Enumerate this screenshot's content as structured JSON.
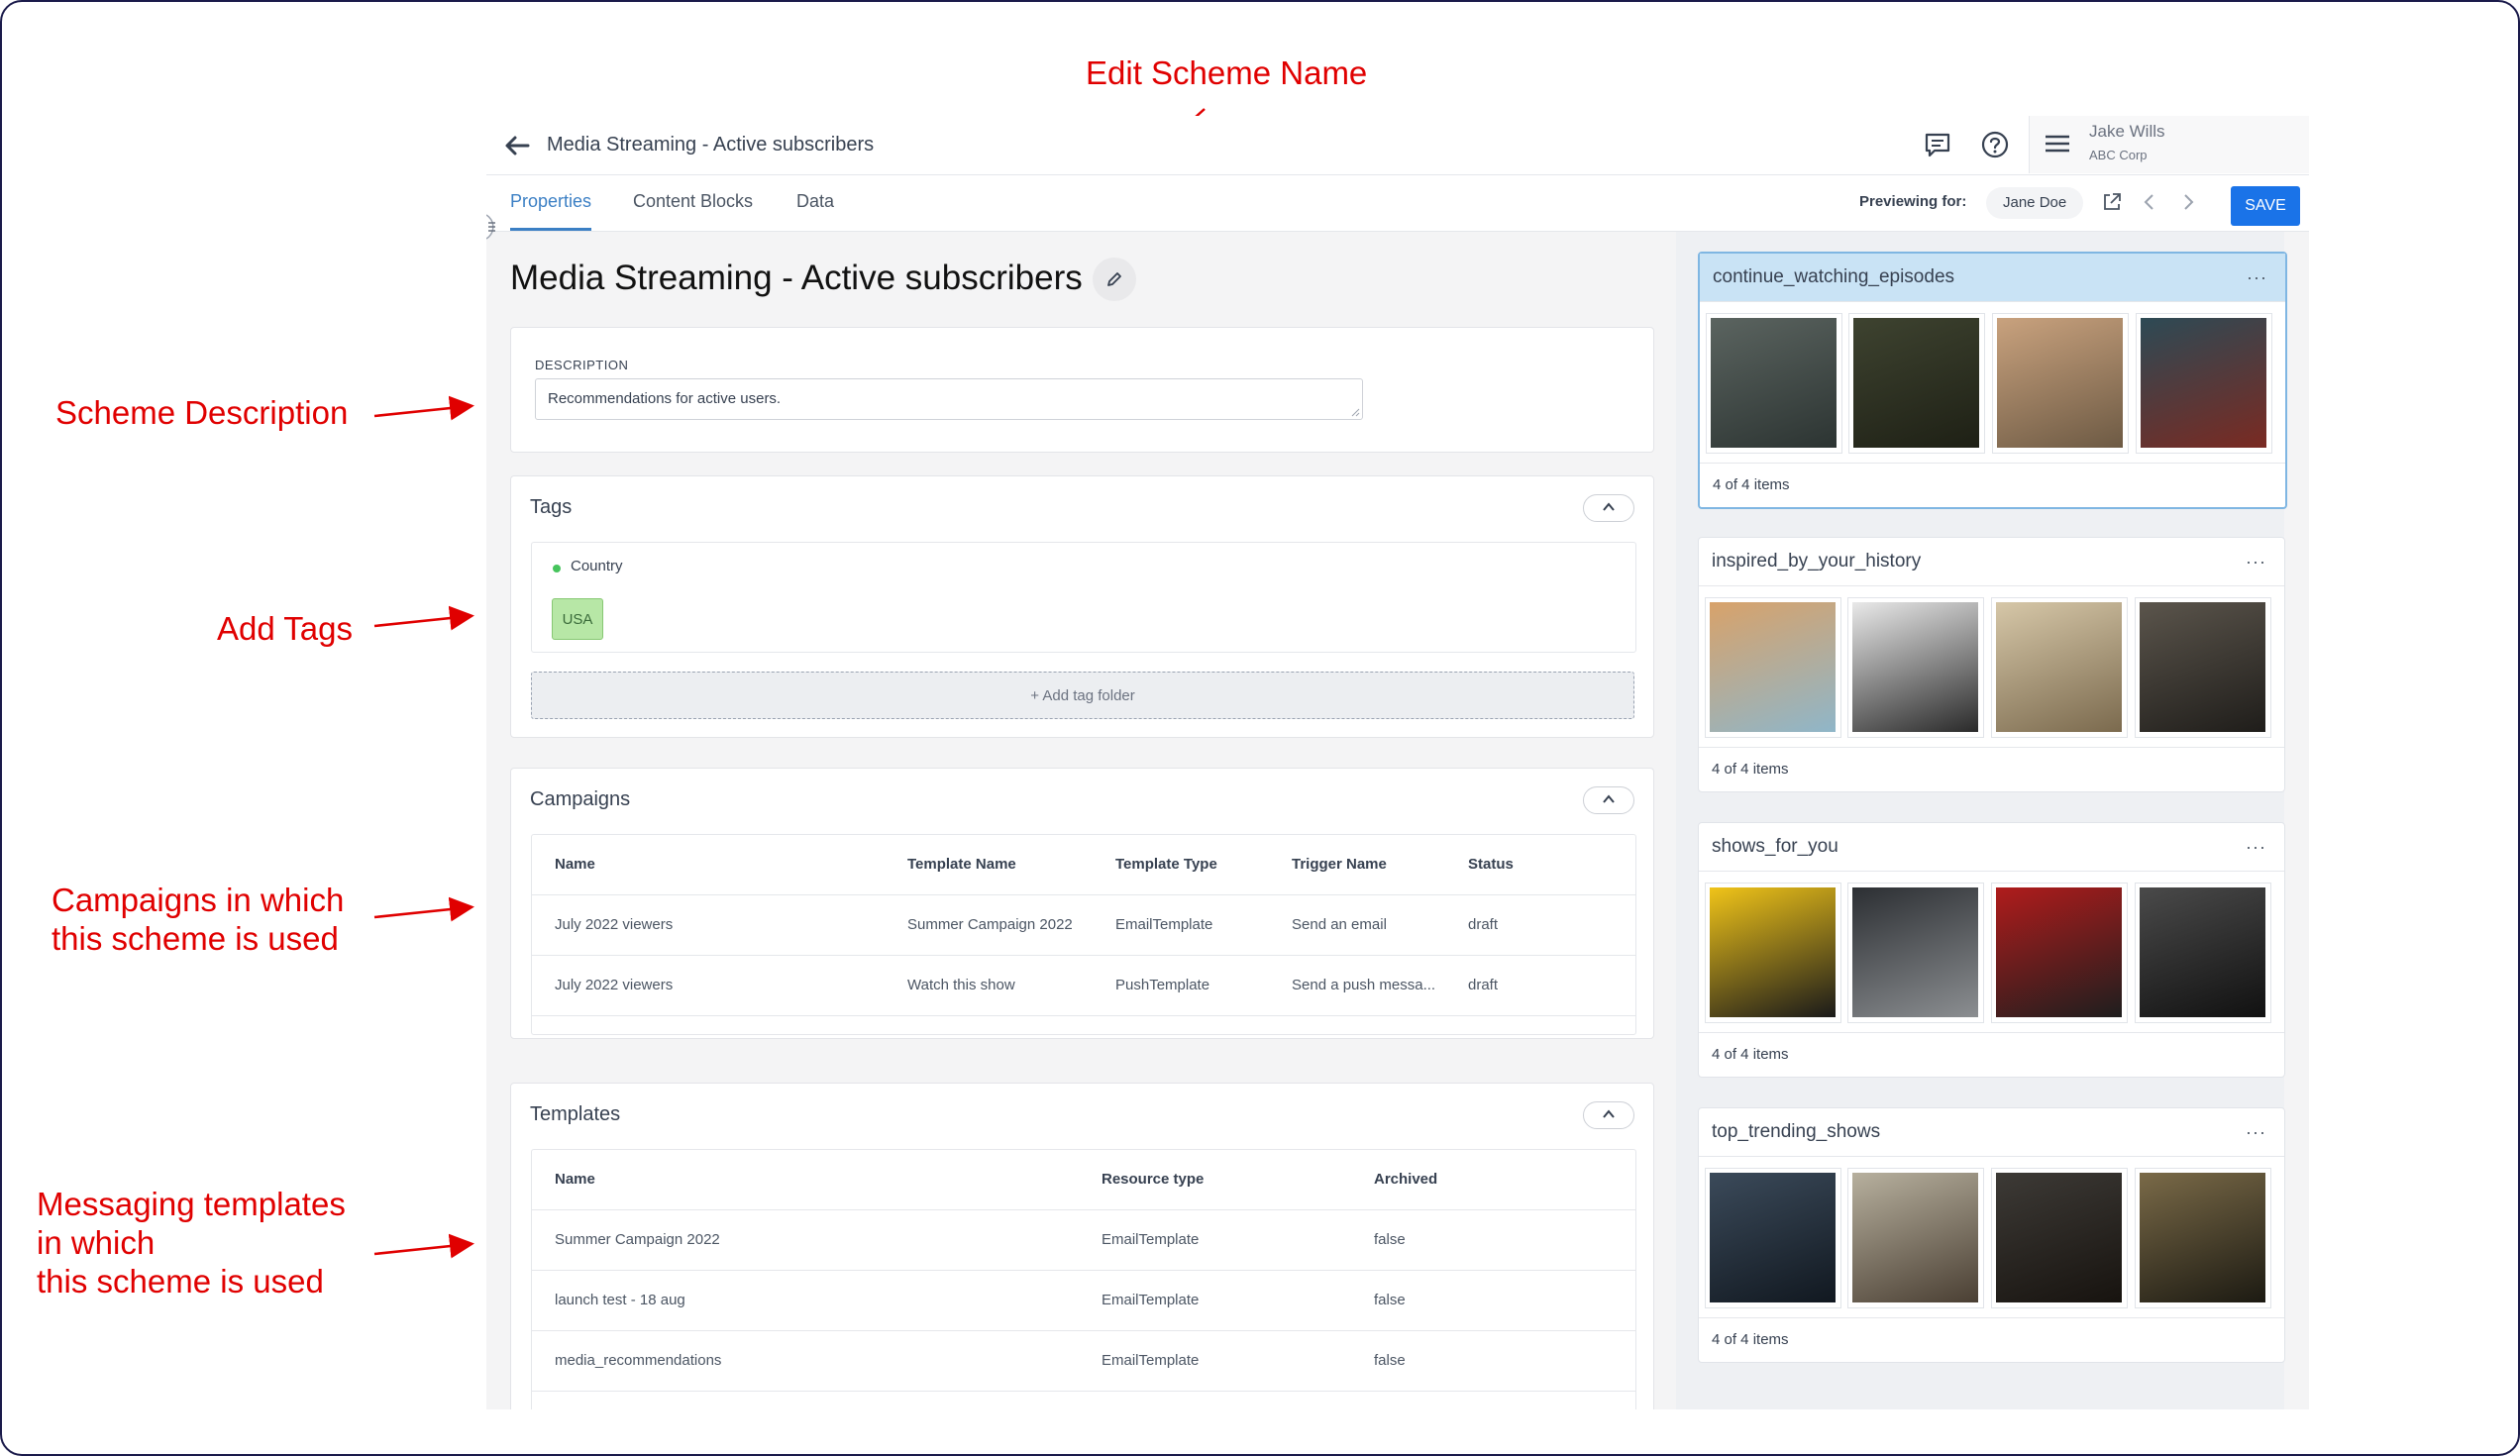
{
  "annotations": {
    "edit_name": "Edit Scheme Name",
    "description": "Scheme Description",
    "tags": "Add Tags",
    "campaigns": "Campaigns in which\nthis scheme is used",
    "templates": "Messaging templates\n in which\nthis scheme is used"
  },
  "header": {
    "title": "Media Streaming - Active subscribers",
    "user_name": "Jake Wills",
    "user_org": "ABC Corp"
  },
  "tabs": [
    {
      "label": "Properties",
      "active": true
    },
    {
      "label": "Content Blocks",
      "active": false
    },
    {
      "label": "Data",
      "active": false
    }
  ],
  "preview": {
    "label": "Previewing for:",
    "user": "Jane Doe",
    "save_label": "SAVE"
  },
  "scheme": {
    "title": "Media Streaming - Active subscribers",
    "description_label": "DESCRIPTION",
    "description": "Recommendations for active users."
  },
  "tags": {
    "heading": "Tags",
    "folder": "Country",
    "chips": [
      "USA"
    ],
    "add_label": "+ Add tag folder"
  },
  "campaigns": {
    "heading": "Campaigns",
    "columns": [
      "Name",
      "Template Name",
      "Template Type",
      "Trigger Name",
      "Status"
    ],
    "rows": [
      [
        "July 2022 viewers",
        "Summer Campaign 2022",
        "EmailTemplate",
        "Send an email",
        "draft"
      ],
      [
        "July 2022 viewers",
        "Watch this show",
        "PushTemplate",
        "Send a push messa...",
        "draft"
      ]
    ]
  },
  "templates": {
    "heading": "Templates",
    "columns": [
      "Name",
      "Resource type",
      "Archived"
    ],
    "rows": [
      [
        "Summer Campaign 2022",
        "EmailTemplate",
        "false"
      ],
      [
        "launch test - 18 aug",
        "EmailTemplate",
        "false"
      ],
      [
        "media_recommendations",
        "EmailTemplate",
        "false"
      ]
    ]
  },
  "content_blocks": [
    {
      "name": "continue_watching_episodes",
      "count": "4 of 4 items",
      "selected": true,
      "thumbs": [
        [
          "#5b6460",
          "#2c3432"
        ],
        [
          "#3e4330",
          "#1e2015"
        ],
        [
          "#c9a27e",
          "#6d5a44"
        ],
        [
          "#2d4a55",
          "#7a2a22"
        ]
      ]
    },
    {
      "name": "inspired_by_your_history",
      "count": "4 of 4 items",
      "selected": false,
      "thumbs": [
        [
          "#d8a26a",
          "#8fb6c9"
        ],
        [
          "#e9e9e9",
          "#2a2a2a"
        ],
        [
          "#d6c7a8",
          "#7b6a4e"
        ],
        [
          "#5b554c",
          "#1f1d1a"
        ]
      ]
    },
    {
      "name": "shows_for_you",
      "count": "4 of 4 items",
      "selected": false,
      "thumbs": [
        [
          "#f0c419",
          "#1a1a1a"
        ],
        [
          "#2c2f33",
          "#8b8e91"
        ],
        [
          "#b01c1c",
          "#1e1e1e"
        ],
        [
          "#4a4a4a",
          "#111111"
        ]
      ]
    },
    {
      "name": "top_trending_shows",
      "count": "4 of 4 items",
      "selected": false,
      "thumbs": [
        [
          "#3b4a5a",
          "#111820"
        ],
        [
          "#b7b09e",
          "#4a3f33"
        ],
        [
          "#3d3a36",
          "#17130f"
        ],
        [
          "#7a6a48",
          "#1c1a12"
        ]
      ]
    }
  ],
  "colors": {
    "accent": "#3b7fc4",
    "save": "#1a73e8",
    "annotation": "#e00000",
    "tag_chip": "#b7e7a6",
    "selected_block": "#c9e3f5"
  },
  "icons": [
    "back-arrow-icon",
    "chat-icon",
    "help-icon",
    "menu-icon",
    "pencil-icon",
    "chevron-up-icon",
    "external-link-icon",
    "chevron-left-icon",
    "chevron-right-icon",
    "more-icon"
  ]
}
